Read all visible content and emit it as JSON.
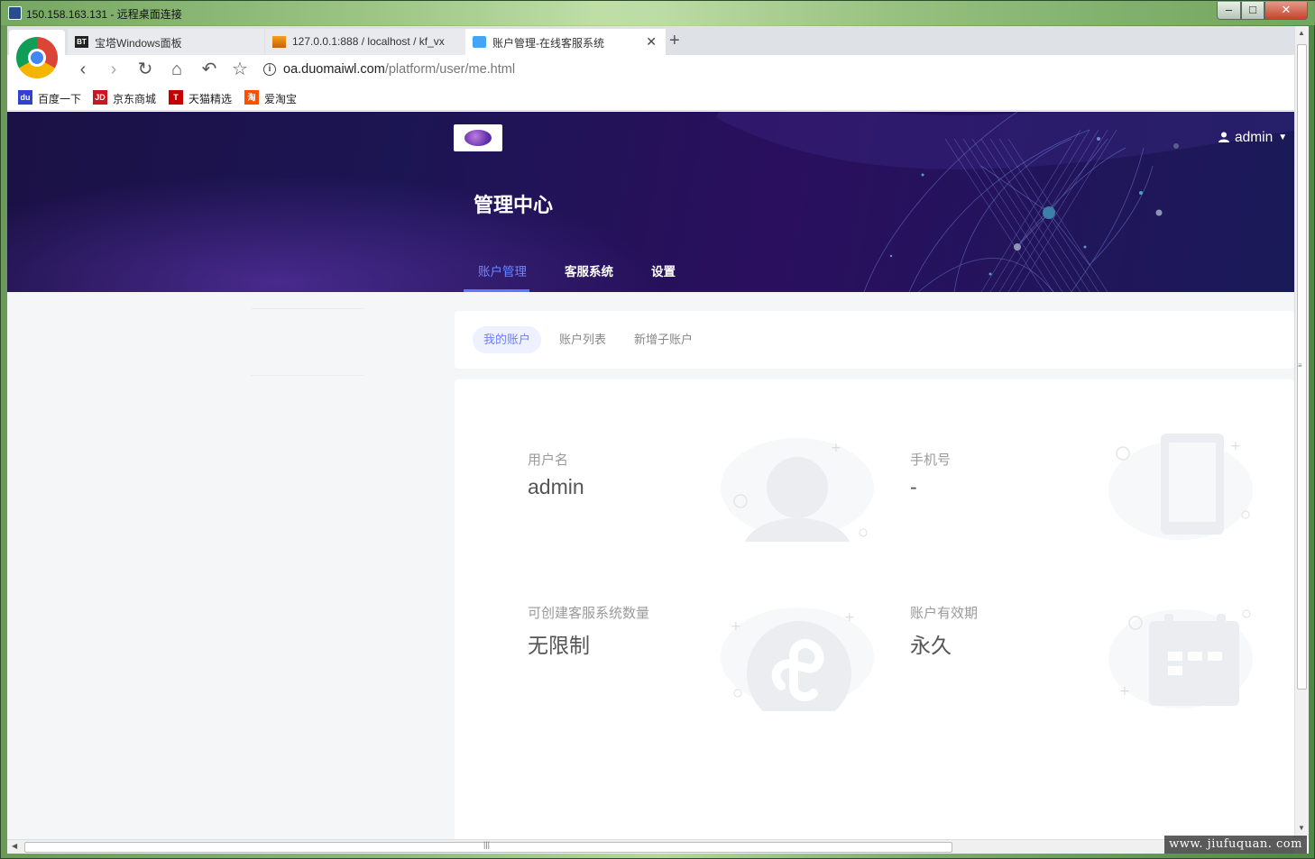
{
  "window": {
    "title": "150.158.163.131 - 远程桌面连接"
  },
  "browser": {
    "tabs": [
      {
        "favicon": "BT",
        "label": "宝塔Windows面板"
      },
      {
        "favicon": "PMA",
        "label": "127.0.0.1:888 / localhost / kf_vx"
      },
      {
        "favicon": "cloud",
        "label": "账户管理-在线客服系统"
      }
    ],
    "url": {
      "host": "oa.duomaiwl.com",
      "path": "/platform/user/me.html"
    },
    "bookmarks": [
      {
        "icon_text": "du",
        "label": "百度一下"
      },
      {
        "icon_text": "JD",
        "label": "京东商城"
      },
      {
        "icon_text": "T",
        "label": "天猫精选"
      },
      {
        "icon_text": "淘",
        "label": "爱淘宝"
      }
    ]
  },
  "header": {
    "title": "管理中心",
    "user": "admin",
    "nav": [
      "账户管理",
      "客服系统",
      "设置"
    ],
    "active_nav": 0
  },
  "subnav": {
    "tabs": [
      "我的账户",
      "账户列表",
      "新增子账户"
    ],
    "active": 0
  },
  "account_info": {
    "username_label": "用户名",
    "username_value": "admin",
    "phone_label": "手机号",
    "phone_value": "-",
    "quota_label": "可创建客服系统数量",
    "quota_value": "无限制",
    "validity_label": "账户有效期",
    "validity_value": "永久"
  },
  "watermark": "www. jiufuquan. com",
  "colors": {
    "header_bg": "#1c1553",
    "accent": "#5f78ff",
    "active_subtab_bg": "#eef1ff",
    "page_bg": "#f5f6f8"
  }
}
